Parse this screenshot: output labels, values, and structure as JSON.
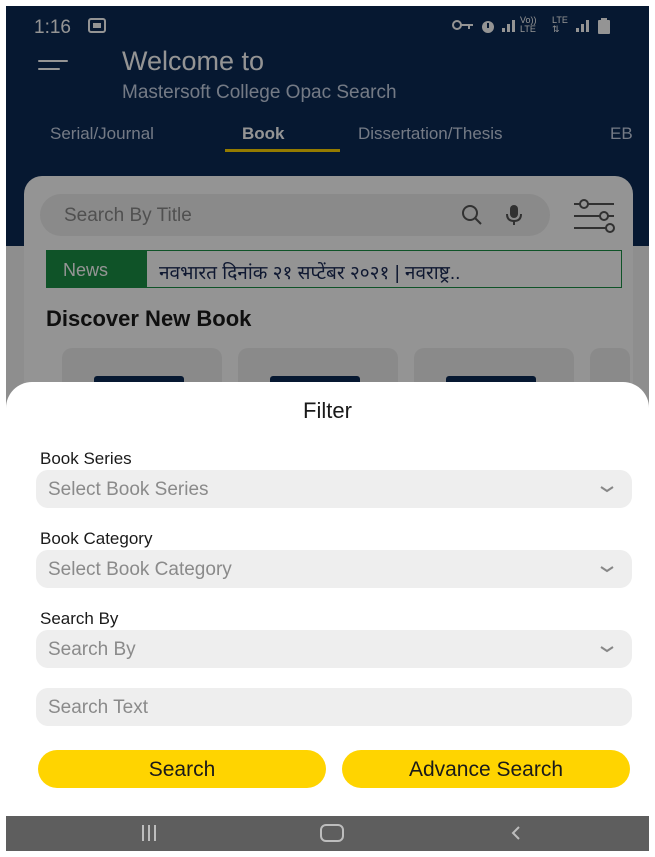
{
  "status_bar": {
    "time": "1:16",
    "left_icons": [
      "notification-icon"
    ],
    "right_icons": [
      "vpn-key-icon",
      "alarm-icon",
      "signal-icon",
      "volte-lte-icon",
      "lte-icon",
      "signal-icon",
      "battery-icon"
    ],
    "volte_label": "Vo))",
    "lte_label": "LTE"
  },
  "header": {
    "welcome": "Welcome to",
    "subtitle": "Mastersoft College Opac Search",
    "menu_icon": "hamburger-menu-icon"
  },
  "tabs": [
    {
      "label": "Serial/Journal",
      "active": false
    },
    {
      "label": "Book",
      "active": true
    },
    {
      "label": "Dissertation/Thesis",
      "active": false
    },
    {
      "label": "EB",
      "active": false
    }
  ],
  "search": {
    "placeholder": "Search By Title",
    "icons": [
      "search-icon",
      "microphone-icon",
      "filter-sliders-icon"
    ]
  },
  "news": {
    "tag": "News",
    "text": "नवभारत दिनांक २१ सप्टेंबर २०२१ | नवराष्ट्र.."
  },
  "discover": {
    "title": "Discover New Book"
  },
  "filter_sheet": {
    "title": "Filter",
    "fields": [
      {
        "label": "Book Series",
        "placeholder": "Select Book Series"
      },
      {
        "label": "Book Category",
        "placeholder": "Select Book Category"
      },
      {
        "label": "Search By",
        "placeholder": "Search By"
      }
    ],
    "search_text_placeholder": "Search Text",
    "search_button": "Search",
    "advance_search_button": "Advance Search"
  },
  "colors": {
    "header_bg": "#0b2a55",
    "accent_yellow": "#ffd400",
    "news_green": "#1b8f46"
  },
  "nav_bar": {
    "icons": [
      "recents-icon",
      "home-icon",
      "back-icon"
    ]
  }
}
